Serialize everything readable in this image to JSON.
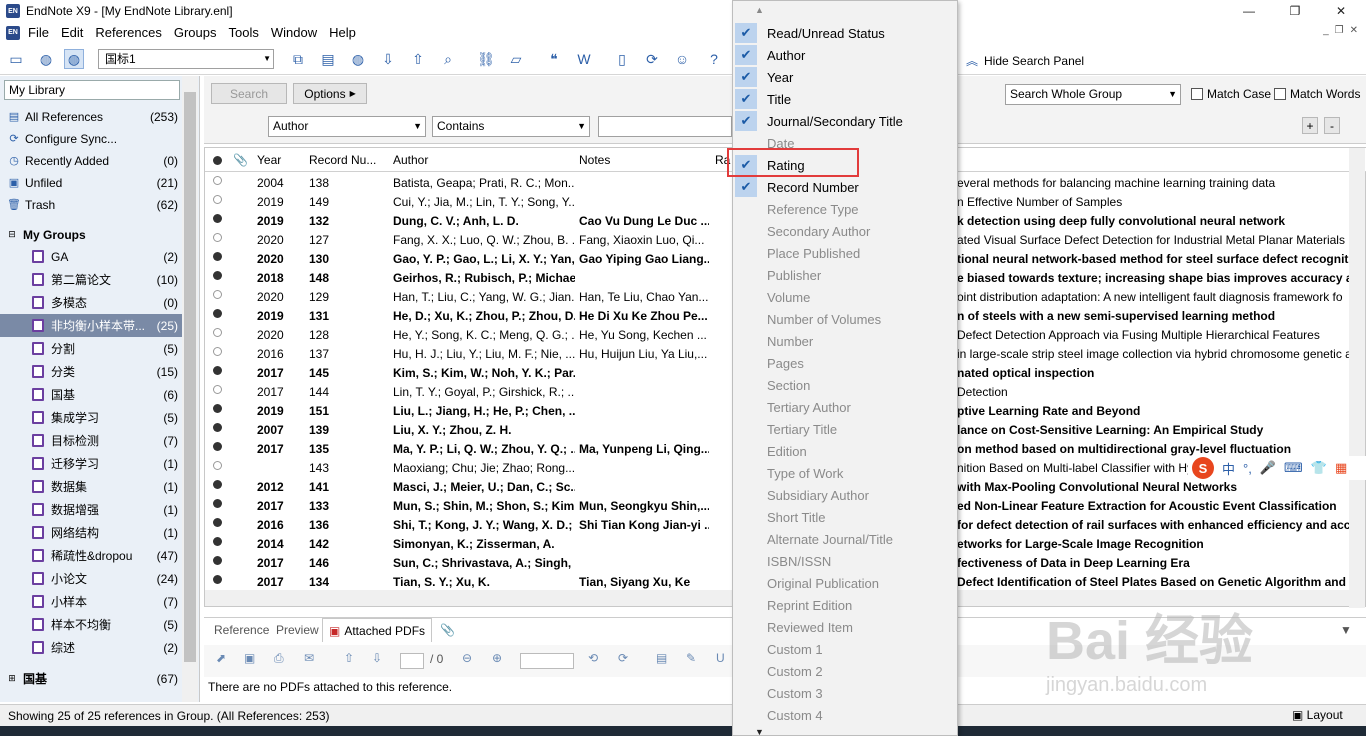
{
  "window": {
    "title": "EndNote X9 - [My EndNote Library.enl]",
    "app_icon_text": "EN",
    "minimize": "—",
    "restore": "❐",
    "close": "✕"
  },
  "menubar": {
    "items": [
      "File",
      "Edit",
      "References",
      "Groups",
      "Tools",
      "Window",
      "Help"
    ],
    "mdi": [
      "_",
      "❐",
      "✕"
    ]
  },
  "toolbar": {
    "style_value": "国标1",
    "hide_search_panel": "Hide Search Panel"
  },
  "sidebar": {
    "library_select": "My Library",
    "top_items": [
      {
        "label": "All References",
        "count": "(253)",
        "icon": "library-icon"
      },
      {
        "label": "Configure Sync...",
        "count": "",
        "icon": "sync-icon"
      },
      {
        "label": "Recently Added",
        "count": "(0)",
        "icon": "clock-icon"
      },
      {
        "label": "Unfiled",
        "count": "(21)",
        "icon": "unfiled-icon"
      },
      {
        "label": "Trash",
        "count": "(62)",
        "icon": "trash-icon"
      }
    ],
    "my_groups_label": "My Groups",
    "groups": [
      {
        "label": "GA",
        "count": "(2)"
      },
      {
        "label": "第二篇论文",
        "count": "(10)"
      },
      {
        "label": "多模态",
        "count": "(0)"
      },
      {
        "label": "非均衡小样本带...",
        "count": "(25)"
      },
      {
        "label": "分割",
        "count": "(5)"
      },
      {
        "label": "分类",
        "count": "(15)"
      },
      {
        "label": "国基",
        "count": "(6)"
      },
      {
        "label": "集成学习",
        "count": "(5)"
      },
      {
        "label": "目标检测",
        "count": "(7)"
      },
      {
        "label": "迁移学习",
        "count": "(1)"
      },
      {
        "label": "数据集",
        "count": "(1)"
      },
      {
        "label": "数据增强",
        "count": "(1)"
      },
      {
        "label": "网络结构",
        "count": "(1)"
      },
      {
        "label": "稀疏性&dropou",
        "count": "(47)"
      },
      {
        "label": "小论文",
        "count": "(24)"
      },
      {
        "label": "小样本",
        "count": "(7)"
      },
      {
        "label": "样本不均衡",
        "count": "(5)"
      },
      {
        "label": "综述",
        "count": "(2)"
      }
    ],
    "bottom_group": {
      "label": "国基",
      "count": "(67)"
    }
  },
  "search": {
    "search_button": "Search",
    "options_button": "Options",
    "field": "Author",
    "operator": "Contains",
    "scope": "Search Whole Group",
    "match_case": "Match Case",
    "match_words": "Match Words",
    "add": "+",
    "remove": "-"
  },
  "reflist": {
    "columns": {
      "year": "Year",
      "record": "Record Nu...",
      "author": "Author",
      "notes": "Notes",
      "rating": "Ra"
    },
    "rows": [
      {
        "read": true,
        "year": "2004",
        "rec": "138",
        "author": "Batista, Geapa; Prati, R. C.; Mon...",
        "notes": "",
        "title": "everal methods for balancing machine learning training data"
      },
      {
        "read": true,
        "year": "2019",
        "rec": "149",
        "author": "Cui, Y.; Jia, M.; Lin, T. Y.; Song, Y....",
        "notes": "",
        "title": "n Effective Number of Samples"
      },
      {
        "read": false,
        "year": "2019",
        "rec": "132",
        "author": "Dung, C. V.; Anh, L. D.",
        "notes": "Cao Vu Dung Le Duc ...",
        "title": "k detection using deep fully convolutional neural network"
      },
      {
        "read": true,
        "year": "2020",
        "rec": "127",
        "author": "Fang, X. X.; Luo, Q. W.; Zhou, B. ...",
        "notes": "Fang, Xiaoxin Luo, Qi...",
        "title": "ated Visual Surface Defect Detection for Industrial Metal Planar Materials"
      },
      {
        "read": false,
        "year": "2020",
        "rec": "130",
        "author": "Gao, Y. P.; Gao, L.; Li, X. Y.; Yan, ...",
        "notes": "Gao Yiping Gao Liang...",
        "title": "tional neural network-based method for steel surface defect recogniti"
      },
      {
        "read": false,
        "year": "2018",
        "rec": "148",
        "author": "Geirhos, R.; Rubisch, P.; Michae...",
        "notes": "",
        "title": "e biased towards texture; increasing shape bias improves accuracy and"
      },
      {
        "read": true,
        "year": "2020",
        "rec": "129",
        "author": "Han, T.; Liu, C.; Yang, W. G.; Jian...",
        "notes": "Han, Te Liu, Chao Yan...",
        "title": "oint distribution adaptation: A new intelligent fault diagnosis framework fo"
      },
      {
        "read": false,
        "year": "2019",
        "rec": "131",
        "author": "He, D.; Xu, K.; Zhou, P.; Zhou, D...",
        "notes": "He Di Xu Ke Zhou Pe...",
        "title": "n of steels with a new semi-supervised learning method"
      },
      {
        "read": true,
        "year": "2020",
        "rec": "128",
        "author": "He, Y.; Song, K. C.; Meng, Q. G.; ...",
        "notes": "He, Yu Song, Kechen ...",
        "title": "Defect Detection Approach via Fusing Multiple Hierarchical Features"
      },
      {
        "read": true,
        "year": "2016",
        "rec": "137",
        "author": "Hu, H. J.; Liu, Y.; Liu, M. F.; Nie, ...",
        "notes": "Hu, Huijun Liu, Ya Liu,...",
        "title": "in large-scale strip steel image collection via hybrid chromosome genetic a"
      },
      {
        "read": false,
        "year": "2017",
        "rec": "145",
        "author": "Kim, S.; Kim, W.; Noh, Y. K.; Par...",
        "notes": "",
        "title": "nated optical inspection"
      },
      {
        "read": true,
        "year": "2017",
        "rec": "144",
        "author": "Lin, T. Y.; Goyal, P.; Girshick, R.; ...",
        "notes": "",
        "title": "Detection"
      },
      {
        "read": false,
        "year": "2019",
        "rec": "151",
        "author": "Liu, L.; Jiang, H.; He, P.; Chen, ...",
        "notes": "",
        "title": "ptive Learning Rate and Beyond"
      },
      {
        "read": false,
        "year": "2007",
        "rec": "139",
        "author": "Liu, X. Y.; Zhou, Z. H.",
        "notes": "",
        "title": "lance on Cost-Sensitive Learning: An Empirical Study"
      },
      {
        "read": false,
        "year": "2017",
        "rec": "135",
        "author": "Ma, Y. P.; Li, Q. W.; Zhou, Y. Q.; ...",
        "notes": "Ma, Yunpeng Li, Qing...",
        "title": "on method based on multidirectional gray-level fluctuation"
      },
      {
        "read": true,
        "year": "",
        "rec": "143",
        "author": "Maoxiang; Chu; Jie; Zhao; Rong...",
        "notes": "",
        "title": "nition Based on Multi-label Classifier with Hy"
      },
      {
        "read": false,
        "year": "2012",
        "rec": "141",
        "author": "Masci, J.; Meier, U.; Dan, C.; Sc...",
        "notes": "",
        "title": "with Max-Pooling Convolutional Neural Networks"
      },
      {
        "read": false,
        "year": "2017",
        "rec": "133",
        "author": "Mun, S.; Shin, M.; Shon, S.; Kim...",
        "notes": "Mun, Seongkyu Shin,...",
        "title": "ed Non-Linear Feature Extraction for Acoustic Event Classification"
      },
      {
        "read": false,
        "year": "2016",
        "rec": "136",
        "author": "Shi, T.; Kong, J. Y.; Wang, X. D.; ...",
        "notes": "Shi Tian Kong Jian-yi ...",
        "title": "for defect detection of rail surfaces with enhanced efficiency and accu"
      },
      {
        "read": false,
        "year": "2014",
        "rec": "142",
        "author": "Simonyan, K.; Zisserman, A.",
        "notes": "",
        "title": "etworks for Large-Scale Image Recognition"
      },
      {
        "read": false,
        "year": "2017",
        "rec": "146",
        "author": "Sun, C.; Shrivastava, A.; Singh, ...",
        "notes": "",
        "title": "fectiveness of Data in Deep Learning Era"
      },
      {
        "read": false,
        "year": "2017",
        "rec": "134",
        "author": "Tian, S. Y.; Xu, K.",
        "notes": "Tian, Siyang Xu, Ke",
        "title": "Defect Identification of Steel Plates Based on Genetic Algorithm and Ex"
      }
    ]
  },
  "bottom": {
    "tabs": [
      "Reference",
      "Preview",
      "Attached PDFs"
    ],
    "page_value": "/ 0",
    "no_pdfs": "There are no PDFs attached to this reference."
  },
  "status": {
    "text": "Showing 25 of 25 references in Group. (All References: 253)",
    "layout": "Layout"
  },
  "column_menu": {
    "items": [
      {
        "label": "Read/Unread Status",
        "checked": true
      },
      {
        "label": "Author",
        "checked": true
      },
      {
        "label": "Year",
        "checked": true
      },
      {
        "label": "Title",
        "checked": true
      },
      {
        "label": "Journal/Secondary Title",
        "checked": true
      },
      {
        "label": "Date",
        "checked": false
      },
      {
        "label": "Rating",
        "checked": true
      },
      {
        "label": "Record Number",
        "checked": true
      },
      {
        "label": "Reference Type",
        "checked": false
      },
      {
        "label": "Secondary Author",
        "checked": false
      },
      {
        "label": "Place Published",
        "checked": false
      },
      {
        "label": "Publisher",
        "checked": false
      },
      {
        "label": "Volume",
        "checked": false
      },
      {
        "label": "Number of Volumes",
        "checked": false
      },
      {
        "label": "Number",
        "checked": false
      },
      {
        "label": "Pages",
        "checked": false
      },
      {
        "label": "Section",
        "checked": false
      },
      {
        "label": "Tertiary Author",
        "checked": false
      },
      {
        "label": "Tertiary Title",
        "checked": false
      },
      {
        "label": "Edition",
        "checked": false
      },
      {
        "label": "Type of Work",
        "checked": false
      },
      {
        "label": "Subsidiary Author",
        "checked": false
      },
      {
        "label": "Short Title",
        "checked": false
      },
      {
        "label": "Alternate Journal/Title",
        "checked": false
      },
      {
        "label": "ISBN/ISSN",
        "checked": false
      },
      {
        "label": "Original Publication",
        "checked": false
      },
      {
        "label": "Reprint Edition",
        "checked": false
      },
      {
        "label": "Reviewed Item",
        "checked": false
      },
      {
        "label": "Custom 1",
        "checked": false
      },
      {
        "label": "Custom 2",
        "checked": false
      },
      {
        "label": "Custom 3",
        "checked": false
      },
      {
        "label": "Custom 4",
        "checked": false
      }
    ],
    "highlighted": "Rating"
  },
  "ime": {
    "logo": "S",
    "items": [
      "中",
      "°,",
      "🎤",
      "⌨",
      "👕",
      "▦"
    ]
  },
  "watermark": {
    "brand": "Bai 经验",
    "url": "jingyan.baidu.com"
  },
  "colors": {
    "accent": "#2c5fa8",
    "highlight": "#e23b3b",
    "selected_group": "#7a8aa6",
    "check_bg": "#bcd3ee"
  }
}
